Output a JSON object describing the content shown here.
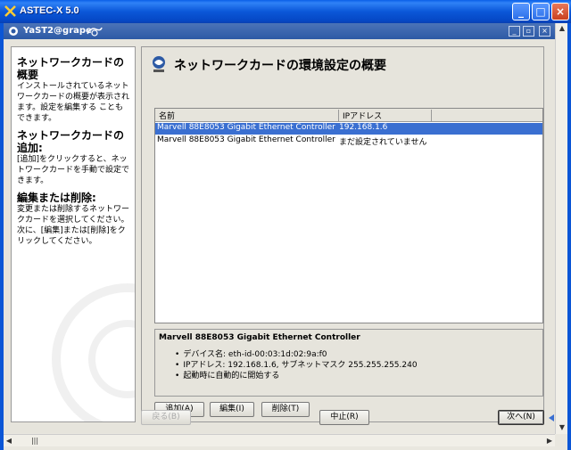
{
  "app": {
    "title": "ASTEC-X 5.0"
  },
  "yast": {
    "title": "YaST2@grape"
  },
  "help": {
    "sections": [
      {
        "heading": "ネットワークカードの概要",
        "body": "インストールされているネットワークカードの概要が表示されます。設定を編集する こともできます。"
      },
      {
        "heading": "ネットワークカードの追加:",
        "body": "[追加]をクリックすると、ネットワークカードを手動で設定できます。"
      },
      {
        "heading": "編集または削除:",
        "body": "変更または削除するネットワークカードを選択してください。次に、[編集]または[削除]をクリックしてください。"
      }
    ]
  },
  "main": {
    "title": "ネットワークカードの環境設定の概要",
    "columns": [
      "名前",
      "IPアドレス"
    ],
    "rows": [
      {
        "name": "Marvell 88E8053 Gigabit Ethernet Controller",
        "ip": "192.168.1.6"
      },
      {
        "name": "Marvell 88E8053 Gigabit Ethernet Controller",
        "ip": "まだ設定されていません"
      }
    ],
    "detail": {
      "title": "Marvell 88E8053 Gigabit Ethernet Controller",
      "items": [
        "デバイス名: eth-id-00:03:1d:02:9a:f0",
        "IPアドレス: 192.168.1.6, サブネットマスク 255.255.255.240",
        "起動時に自動的に開始する"
      ]
    },
    "buttons": {
      "add": "追加(A)",
      "edit": "編集(I)",
      "delete": "削除(T)"
    }
  },
  "footer": {
    "back": "戻る(B)",
    "abort": "中止(R)",
    "next": "次へ(N)"
  },
  "colors": {
    "xp_title": "#0b57d8",
    "selection": "#3a6fd1"
  }
}
